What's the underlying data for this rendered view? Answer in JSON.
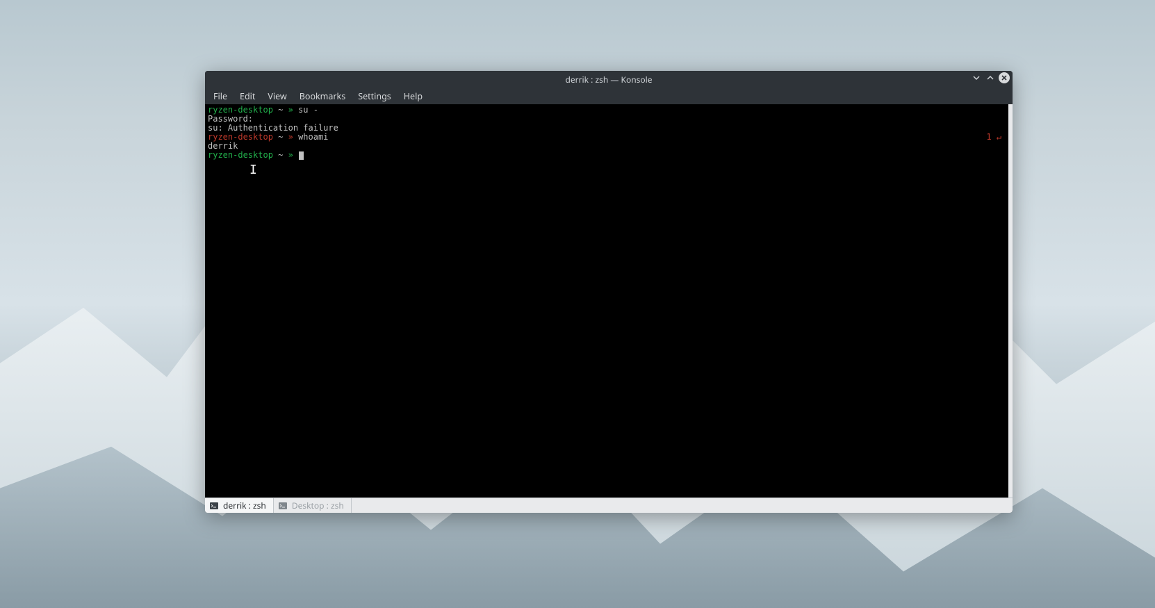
{
  "window": {
    "title": "derrik : zsh — Konsole"
  },
  "menu": {
    "items": [
      "File",
      "Edit",
      "View",
      "Bookmarks",
      "Settings",
      "Help"
    ]
  },
  "terminal": {
    "lines": [
      {
        "host": "ryzen-desktop",
        "path": "~",
        "prompt": "»",
        "cmd": "su -",
        "right": ""
      },
      {
        "plain": "Password:"
      },
      {
        "plain": "su: Authentication failure"
      },
      {
        "host": "ryzen-desktop",
        "path": "~",
        "prompt": "»",
        "host_style": "err",
        "cmd": "whoami",
        "right": "1 ↵"
      },
      {
        "plain": "derrik"
      },
      {
        "host": "ryzen-desktop",
        "path": "~",
        "prompt": "»",
        "cmd": "",
        "cursor": true,
        "right": ""
      }
    ]
  },
  "tabs": [
    {
      "label": "derrik : zsh",
      "active": true
    },
    {
      "label": "Desktop : zsh",
      "active": false
    }
  ]
}
